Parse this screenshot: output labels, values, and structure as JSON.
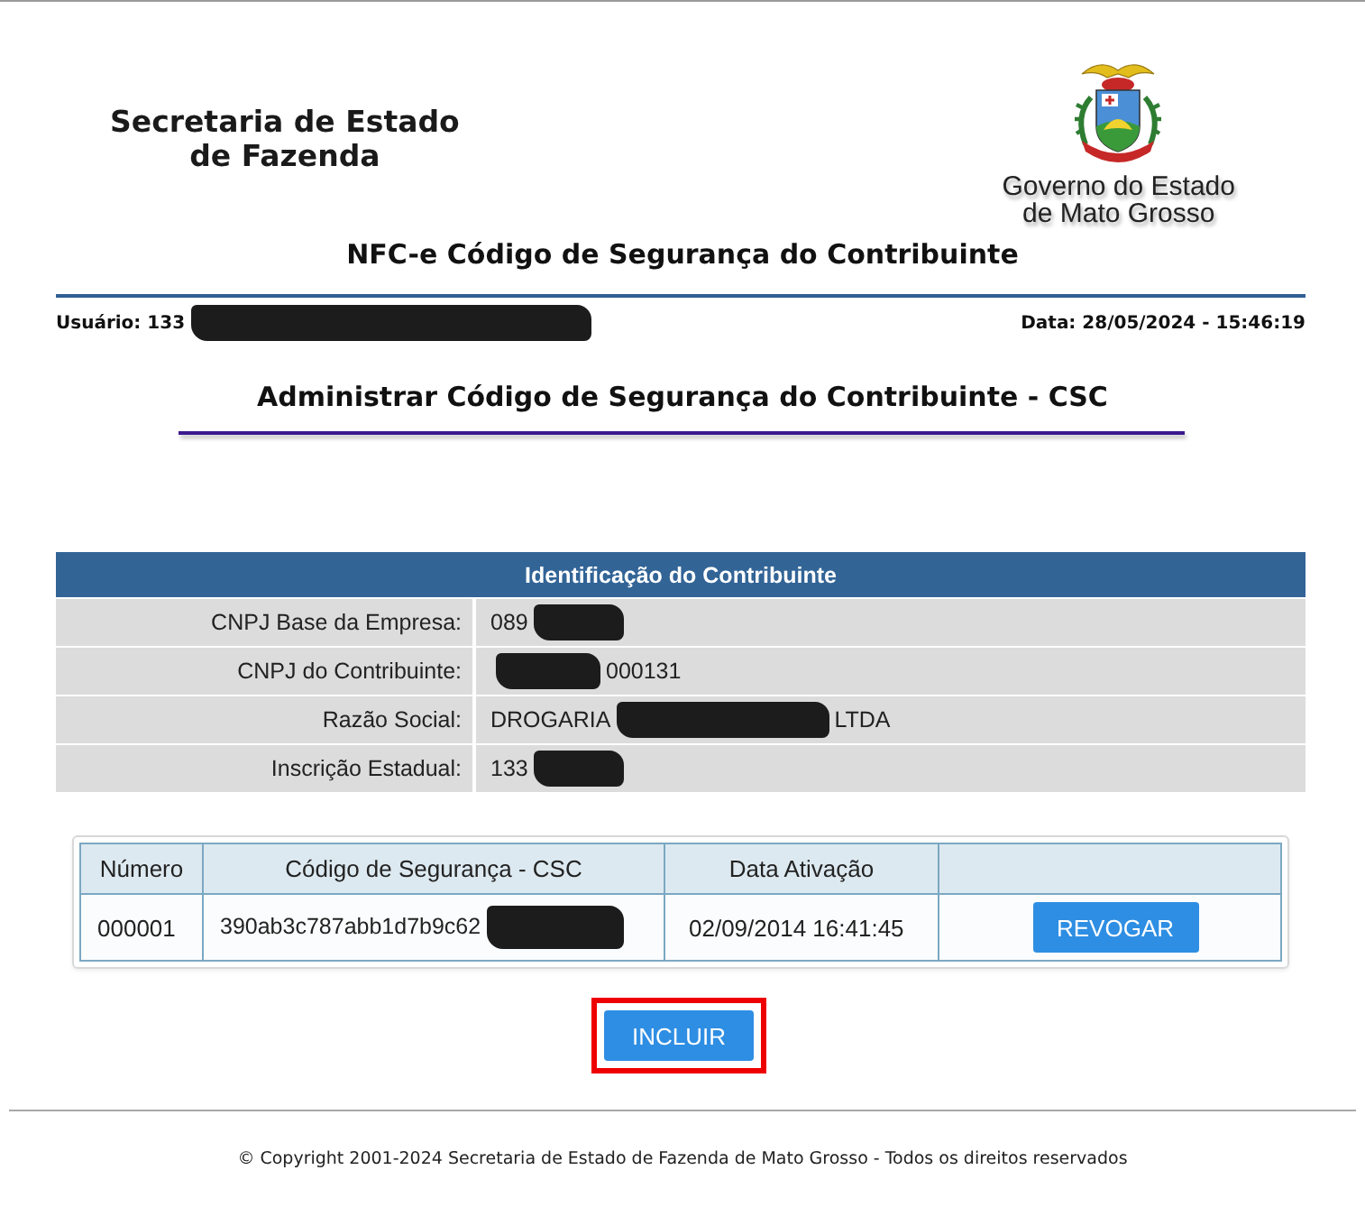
{
  "header": {
    "agency_name_lines": [
      "Secretaria de Estado",
      "de Fazenda"
    ],
    "state_caption_lines": [
      "Governo do Estado",
      "de Mato Grosso"
    ]
  },
  "page_title": "NFC-e Código de Segurança do Contribuinte",
  "session": {
    "user": [
      {
        "kind": "text",
        "text": "Usuário: 133"
      },
      {
        "kind": "redaction"
      }
    ],
    "date": "Data: 28/05/2024 - 15:46:19"
  },
  "section_title": "Administrar Código de Segurança do Contribuinte - CSC",
  "taxpayer": {
    "title": "Identificação do Contribuinte",
    "rows": [
      {
        "label": "CNPJ Base da Empresa:",
        "value": [
          {
            "kind": "text",
            "text": "089"
          },
          {
            "kind": "redaction"
          }
        ]
      },
      {
        "label": "CNPJ do Contribuinte:",
        "value": [
          {
            "kind": "redaction"
          },
          {
            "kind": "text",
            "text": "000131"
          }
        ]
      },
      {
        "label": "Razão Social:",
        "value": [
          {
            "kind": "text",
            "text": "DROGARIA"
          },
          {
            "kind": "redaction"
          },
          {
            "kind": "text",
            "text": "LTDA"
          }
        ]
      },
      {
        "label": "Inscrição Estadual:",
        "value": [
          {
            "kind": "text",
            "text": "133"
          },
          {
            "kind": "redaction"
          }
        ]
      }
    ]
  },
  "csc_table": {
    "columns": [
      "Número",
      "Código de Segurança - CSC",
      "Data Ativação"
    ],
    "rows": [
      {
        "number": "000001",
        "code": [
          {
            "kind": "text",
            "text": "390ab3c787abb1d7b9c62"
          },
          {
            "kind": "redaction"
          }
        ],
        "activation_date": "02/09/2014 16:41:45",
        "action": "REVOGAR"
      }
    ]
  },
  "include_button": {
    "label": "INCLUIR",
    "highlighted": true
  },
  "footer": "© Copyright 2001-2024 Secretaria de Estado de Fazenda de Mato Grosso - Todos os direitos reservados"
}
